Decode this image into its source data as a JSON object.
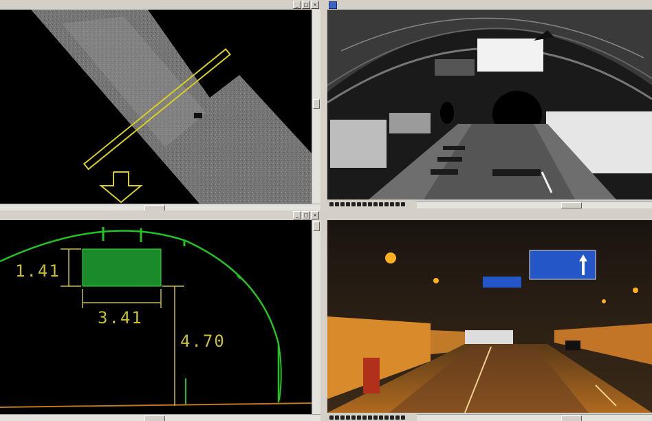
{
  "panes": {
    "top_left": {
      "title": ""
    },
    "top_right": {
      "title": "",
      "toolbar_icons": [
        "zoom-icon",
        "pan-icon",
        "rotate-icon",
        "select-icon",
        "measure-icon",
        "fit-icon",
        "view-icon",
        "layer-icon",
        "render-icon",
        "color-icon",
        "export-icon",
        "help-icon",
        "settings-icon",
        "info-icon"
      ]
    },
    "bottom_left": {
      "title": "",
      "dimensions": {
        "height_box": "1.41",
        "width_box": "3.41",
        "clearance": "4.70"
      }
    },
    "bottom_right": {
      "title": "",
      "toolbar_icons": [
        "zoom-icon",
        "pan-icon",
        "rotate-icon",
        "select-icon",
        "measure-icon",
        "fit-icon",
        "view-icon",
        "layer-icon",
        "render-icon",
        "color-icon",
        "export-icon",
        "help-icon",
        "settings-icon",
        "info-icon"
      ]
    }
  },
  "window_buttons": {
    "minimize": "_",
    "maximize": "□",
    "close": "×"
  },
  "colors": {
    "annotation_yellow": "#d8d020",
    "profile_green": "#22c422",
    "sign_blue": "#2456c8",
    "tunnel_orange": "#d98a2a"
  }
}
